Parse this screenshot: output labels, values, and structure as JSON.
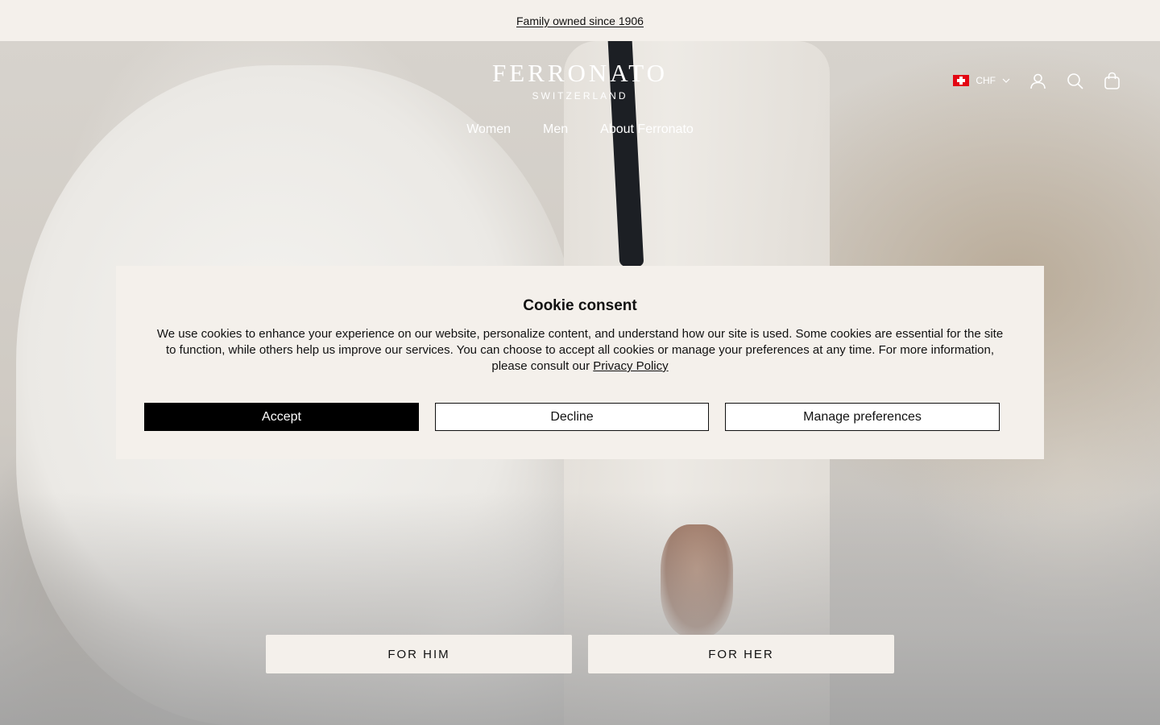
{
  "announcement": {
    "text": "Family owned since 1906"
  },
  "header": {
    "logo": {
      "word": "FERRONATO",
      "sub": "SWITZERLAND"
    },
    "nav": [
      {
        "label": "Women"
      },
      {
        "label": "Men"
      },
      {
        "label": "About Ferronato"
      }
    ],
    "currency": {
      "label": "CHF",
      "flag": "switzerland-flag"
    },
    "icons": [
      "account-icon",
      "search-icon",
      "cart-icon"
    ]
  },
  "cookie_modal": {
    "title": "Cookie consent",
    "body": "We use cookies to enhance your experience on our website, personalize content, and understand how our site is used. Some cookies are essential for the site to function, while others help us improve our services. You can choose to accept all cookies or manage your preferences at any time. For more information, please consult our",
    "privacy_link": "Privacy Policy",
    "accept_label": "Accept",
    "decline_label": "Decline",
    "manage_label": "Manage preferences"
  },
  "hero": {
    "for_him": "FOR HIM",
    "for_her": "FOR HER"
  },
  "colors": {
    "bar_bg": "#f4f0eb",
    "accent": "#000000",
    "hero_text": "#ffffff"
  }
}
